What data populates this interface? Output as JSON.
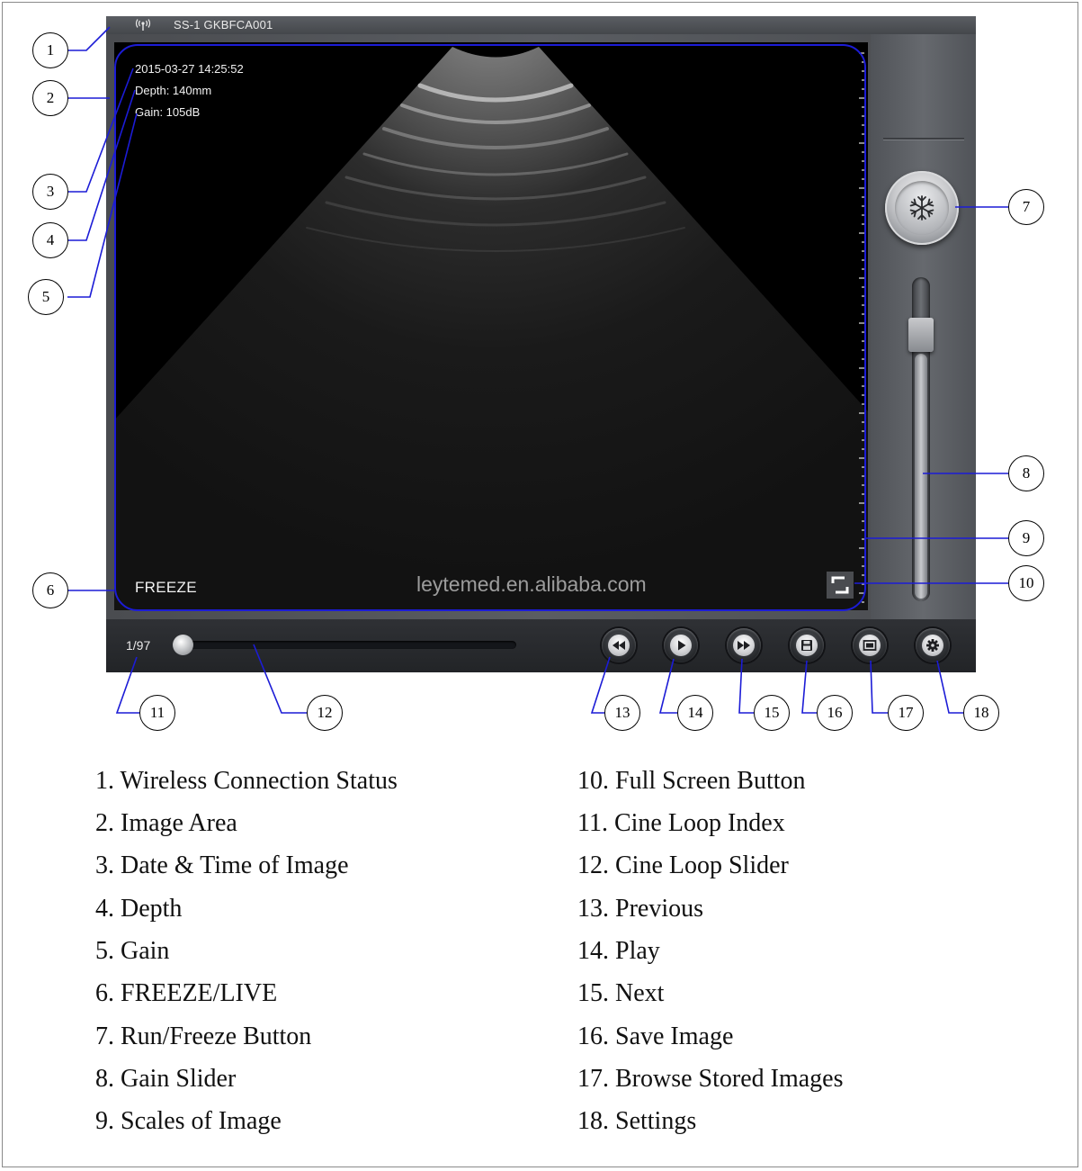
{
  "status_bar": {
    "icon": "wireless-signal-icon",
    "device_id": "SS-1 GKBFCA001"
  },
  "image_info": {
    "datetime": "2015-03-27 14:25:52",
    "depth": "Depth: 140mm",
    "gain": "Gain: 105dB",
    "mode": "FREEZE",
    "watermark": "leytemed.en.alibaba.com"
  },
  "controls": {
    "run_freeze_icon": "snowflake-icon",
    "gain_slider_level": 0.86,
    "fullscreen_icon": "fullscreen-icon",
    "cine_index": "1/97",
    "cine_position": 0.0,
    "buttons": [
      {
        "name": "previous",
        "icon": "rewind-icon"
      },
      {
        "name": "play",
        "icon": "play-icon"
      },
      {
        "name": "next",
        "icon": "fast-forward-icon"
      },
      {
        "name": "save",
        "icon": "floppy-disk-icon"
      },
      {
        "name": "browse",
        "icon": "image-gallery-icon"
      },
      {
        "name": "settings",
        "icon": "gear-icon"
      }
    ]
  },
  "colors": {
    "highlight": "#1c1cd6",
    "panel": "#55585d",
    "bottom_bar": "#26282b"
  },
  "callout_numbers": [
    "1",
    "2",
    "3",
    "4",
    "5",
    "6",
    "7",
    "8",
    "9",
    "10",
    "11",
    "12",
    "13",
    "14",
    "15",
    "16",
    "17",
    "18"
  ],
  "legend": {
    "left": [
      "1. Wireless Connection Status",
      "2. Image Area",
      "3. Date & Time of Image",
      "4. Depth",
      "5. Gain",
      "6. FREEZE/LIVE",
      "7. Run/Freeze Button",
      "8. Gain Slider",
      "9. Scales of Image"
    ],
    "right": [
      "10. Full Screen Button",
      "11. Cine Loop Index",
      "12. Cine Loop Slider",
      "13. Previous",
      "14. Play",
      "15. Next",
      "16. Save Image",
      "17. Browse Stored Images",
      "18. Settings"
    ]
  }
}
